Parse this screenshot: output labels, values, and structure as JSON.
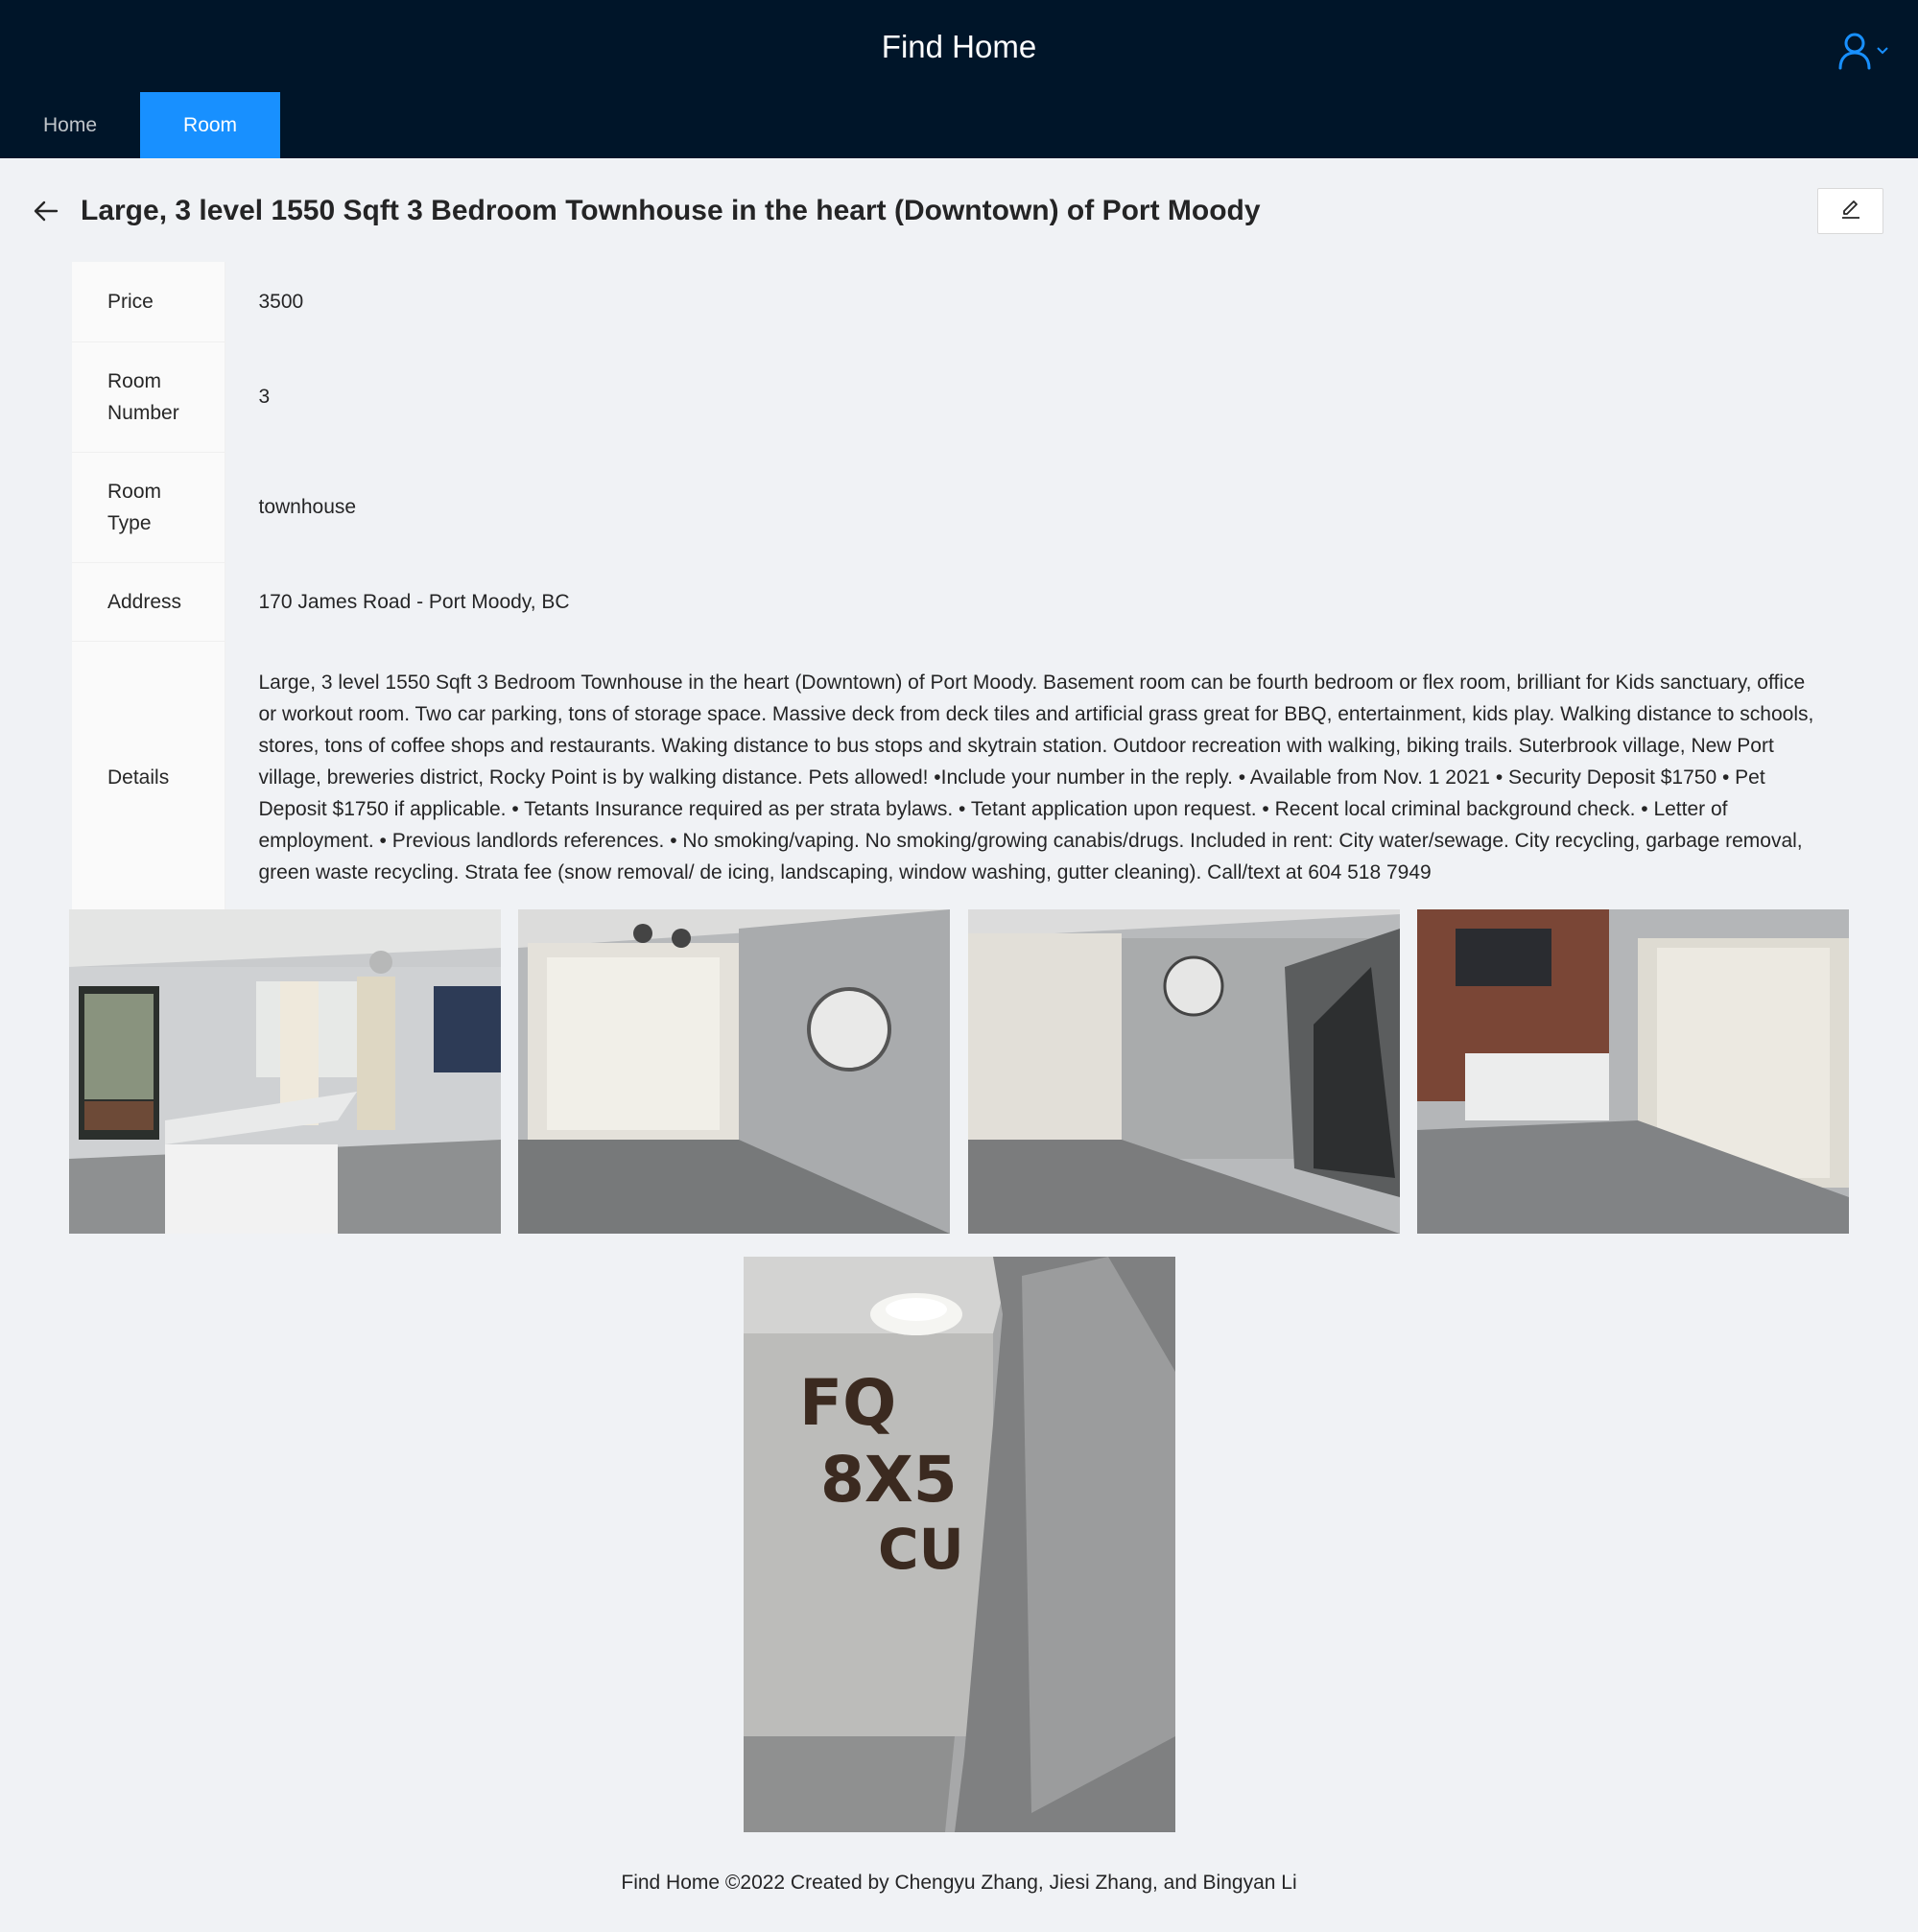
{
  "app": {
    "title": "Find Home"
  },
  "nav": {
    "items": [
      {
        "label": "Home"
      },
      {
        "label": "Room"
      }
    ],
    "active": "Room"
  },
  "page": {
    "title": "Large, 3 level 1550 Sqft 3 Bedroom Townhouse in the heart (Downtown) of Port Moody"
  },
  "details": {
    "price": {
      "label": "Price",
      "value": "3500"
    },
    "room_number": {
      "label": "Room Number",
      "value": "3"
    },
    "room_type": {
      "label": "Room Type",
      "value": "townhouse"
    },
    "address": {
      "label": "Address",
      "value": "170 James Road - Port Moody, BC"
    },
    "details": {
      "label": "Details",
      "value": "Large, 3 level 1550 Sqft 3 Bedroom Townhouse in the heart (Downtown) of Port Moody. Basement room can be fourth bedroom or flex room, brilliant for Kids sanctuary, office or workout room. Two car parking, tons of storage space. Massive deck from deck tiles and artificial grass great for BBQ, entertainment, kids play. Walking distance to schools, stores, tons of coffee shops and restaurants. Waking distance to bus stops and skytrain station. Outdoor recreation with walking, biking trails. Suterbrook village, New Port village, breweries district, Rocky Point is by walking distance. Pets allowed! •Include your number in the reply. • Available from Nov. 1 2021 • Security Deposit $1750 • Pet Deposit $1750 if applicable. • Tetants Insurance required as per strata bylaws. • Tetant application upon request. • Recent local criminal background check. • Letter of employment. • Previous landlords references. • No smoking/vaping. No smoking/growing canabis/drugs. Included in rent: City water/sewage. City recycling, garbage removal, green waste recycling. Strata fee (snow removal/ de icing, landscaping, window washing, gutter cleaning). Call/text at 604 518 7949"
    }
  },
  "photos": {
    "wall_letters": {
      "line1": "FQ",
      "line2": "8X5",
      "line3": "CU"
    }
  },
  "footer": {
    "text": "Find Home ©2022 Created by Chengyu Zhang, Jiesi Zhang, and Bingyan Li"
  },
  "colors": {
    "header_bg": "#001529",
    "accent": "#1890ff",
    "page_bg": "#f0f2f5"
  },
  "icons": {
    "user": "user-icon",
    "dropdown": "chevron-down-icon",
    "back": "arrow-left-icon",
    "edit": "edit-icon"
  }
}
